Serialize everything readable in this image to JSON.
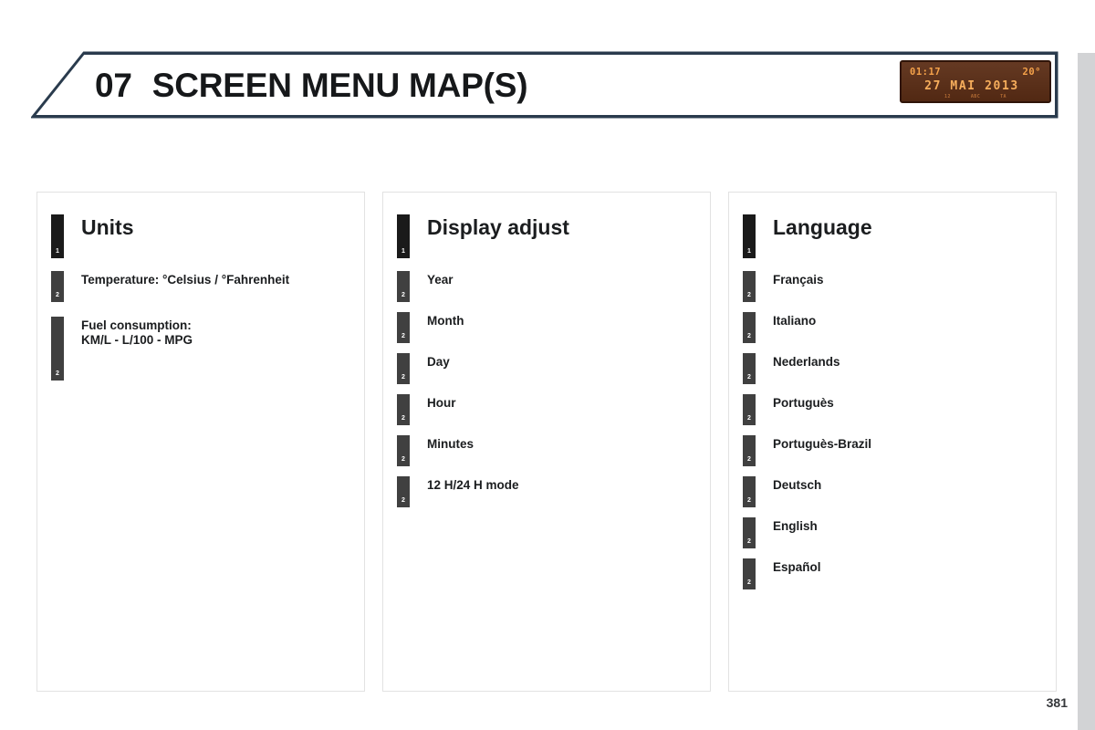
{
  "header": {
    "chapter_number": "07",
    "chapter_title": "SCREEN MENU MAP(S)"
  },
  "lcd_display": {
    "clock": "01:17",
    "temperature": "20°",
    "date": "27 MAI 2013",
    "sub_left": "12",
    "sub_center": "ABC",
    "sub_right": "TA",
    "background_color": "#5b2d15",
    "segment_color": "#f5a24a"
  },
  "panels": [
    {
      "id": "units",
      "heading": "Units",
      "heading_level": "1",
      "items": [
        {
          "label": "Temperature: °Celsius / °Fahrenheit",
          "level": "2",
          "tall": false
        },
        {
          "label": "Fuel consumption:\nKM/L - L/100 - MPG",
          "level": "2",
          "tall": true
        }
      ]
    },
    {
      "id": "display-adjust",
      "heading": "Display adjust",
      "heading_level": "1",
      "items": [
        {
          "label": "Year",
          "level": "2",
          "tall": false
        },
        {
          "label": "Month",
          "level": "2",
          "tall": false
        },
        {
          "label": "Day",
          "level": "2",
          "tall": false
        },
        {
          "label": "Hour",
          "level": "2",
          "tall": false
        },
        {
          "label": "Minutes",
          "level": "2",
          "tall": false
        },
        {
          "label": "12 H/24 H mode",
          "level": "2",
          "tall": false
        }
      ]
    },
    {
      "id": "language",
      "heading": "Language",
      "heading_level": "1",
      "items": [
        {
          "label": "Français",
          "level": "2",
          "tall": false
        },
        {
          "label": "Italiano",
          "level": "2",
          "tall": false
        },
        {
          "label": "Nederlands",
          "level": "2",
          "tall": false
        },
        {
          "label": "Portuguès",
          "level": "2",
          "tall": false
        },
        {
          "label": "Portuguès-Brazil",
          "level": "2",
          "tall": false
        },
        {
          "label": "Deutsch",
          "level": "2",
          "tall": false
        },
        {
          "label": "English",
          "level": "2",
          "tall": false
        },
        {
          "label": "Español",
          "level": "2",
          "tall": false
        }
      ]
    }
  ],
  "footer": {
    "page_number": "381"
  },
  "colors": {
    "header_border": "#2a3b4d",
    "panel_border": "#e2e2e2",
    "marker_level_1": "#1a1a1a",
    "marker_level_2": "#404040",
    "page_edge": "#d2d3d5"
  }
}
